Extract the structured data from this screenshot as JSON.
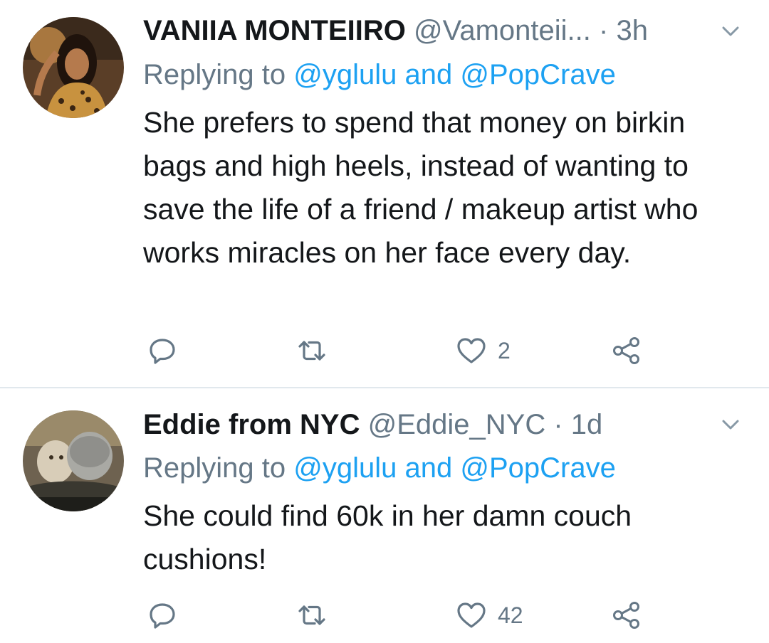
{
  "tweets": [
    {
      "name": "VANIIA MONTEIIRO",
      "handle": "@Vamonteii...",
      "separator": "·",
      "time": "3h",
      "replying_prefix": "Replying to",
      "replying_to_1": "@yglulu",
      "replying_conj": "and",
      "replying_to_2": "@PopCrave",
      "text": "She prefers to spend that money on birkin bags and high heels, instead of wanting to save the life of a friend / makeup artist who works miracles on her face every day.",
      "like_count": "2",
      "avatar_icon": "profile-photo",
      "avatar_colors": [
        "#6b4a2e",
        "#c8923f",
        "#2b1a12"
      ]
    },
    {
      "name": "Eddie from NYC",
      "handle": "@Eddie_NYC",
      "separator": "·",
      "time": "1d",
      "replying_prefix": "Replying to",
      "replying_to_1": "@yglulu",
      "replying_conj": "and",
      "replying_to_2": "@PopCrave",
      "text": "She could find 60k in her damn couch cushions!",
      "like_count": "42",
      "avatar_icon": "profile-photo",
      "avatar_colors": [
        "#8a7a5c",
        "#c9c0ae",
        "#3a3a34"
      ]
    }
  ],
  "icons": {
    "reply": "reply-icon",
    "retweet": "retweet-icon",
    "like": "heart-icon",
    "share": "share-icon",
    "menu": "chevron-down-icon"
  },
  "colors": {
    "text": "#14171a",
    "secondary": "#657786",
    "link": "#1da1f2",
    "divider": "#e1e8ed",
    "background": "#ffffff"
  }
}
